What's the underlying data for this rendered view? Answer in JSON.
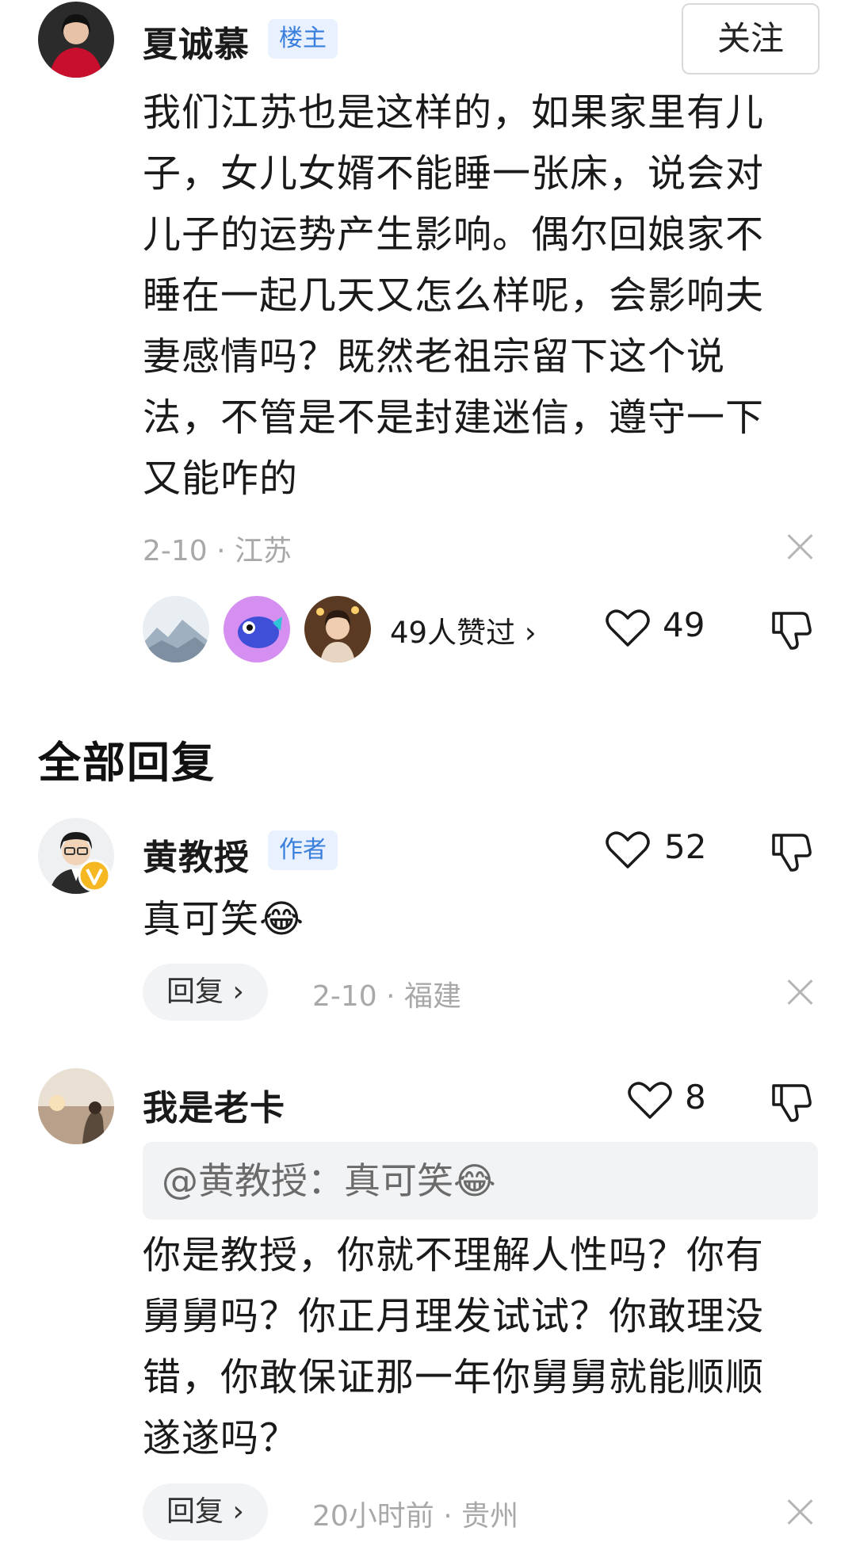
{
  "post": {
    "author": "夏诚慕",
    "author_tag": "楼主",
    "follow_label": "关注",
    "content": "我们江苏也是这样的，如果家里有儿子，女儿女婿不能睡一张床，说会对儿子的运势产生影响。偶尔回娘家不睡在一起几天又怎么样呢，会影响夫妻感情吗？既然老祖宗留下这个说法，不管是不是封建迷信，遵守一下又能咋的",
    "meta": "2-10 · 江苏",
    "likers_text": "49人赞过 ›",
    "like_count": "49"
  },
  "section_title": "全部回复",
  "replies": [
    {
      "author": "黄教授",
      "author_tag": "作者",
      "content": "真可笑😂",
      "like_count": "52",
      "reply_label": "回复 ›",
      "meta": "2-10 · 福建"
    },
    {
      "author": "我是老卡",
      "like_count": "8",
      "quote": "@黄教授：真可笑😂",
      "content": "你是教授，你就不理解人性吗？你有舅舅吗？你正月理发试试？你敢理没错，你敢保证那一年你舅舅就能顺顺遂遂吗？",
      "reply_label": "回复 ›",
      "meta": "20小时前 · 贵州"
    }
  ],
  "colors": {
    "tag_bg": "#e8f1fd",
    "tag_text": "#3a7fdc",
    "meta_gray": "#a8a8a8"
  }
}
